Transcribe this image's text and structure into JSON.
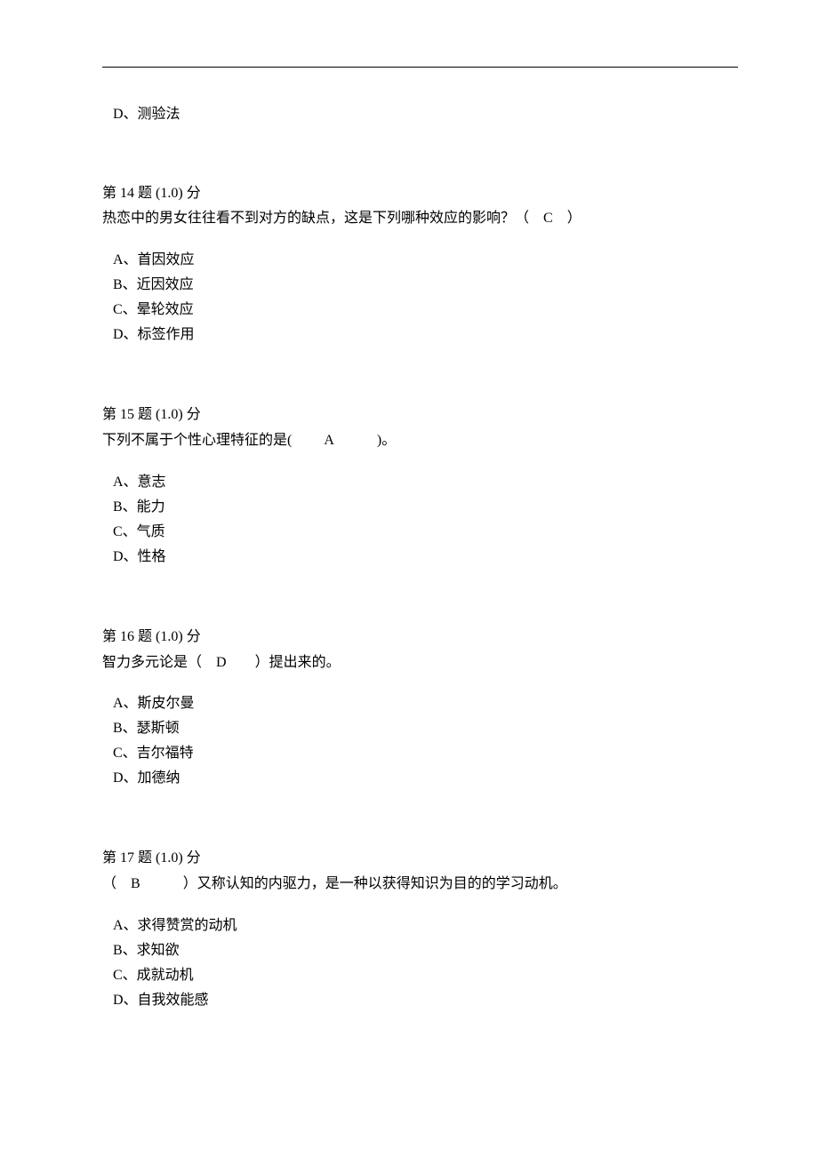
{
  "continuedOption": "D、测验法",
  "questions": [
    {
      "header_prefix": "第 ",
      "header_num": "14",
      "header_suffix": " 题 ",
      "header_points": "(1.0)",
      "header_points_unit": " 分",
      "text_before": "热恋中的男女往往看不到对方的缺点，这是下列哪种效应的影响？（ ",
      "answer": "C",
      "text_after": " ）",
      "options": [
        "A、首因效应",
        "B、近因效应",
        "C、晕轮效应",
        "D、标签作用"
      ]
    },
    {
      "header_prefix": "第 ",
      "header_num": "15",
      "header_suffix": " 题 ",
      "header_points": "(1.0)",
      "header_points_unit": " 分",
      "text_before": "下列不属于个性心理特征的是(   ",
      "answer": "A",
      "text_after": "   )。",
      "options": [
        "A、意志",
        "B、能力",
        "C、气质",
        "D、性格"
      ]
    },
    {
      "header_prefix": "第 ",
      "header_num": "16",
      "header_suffix": " 题 ",
      "header_points": "(1.0)",
      "header_points_unit": " 分",
      "text_before": "智力多元论是（ ",
      "answer": "D",
      "text_after": "  ）提出来的。",
      "options": [
        "A、斯皮尔曼",
        "B、瑟斯顿",
        "C、吉尔福特",
        "D、加德纳"
      ]
    },
    {
      "header_prefix": "第 ",
      "header_num": "17",
      "header_suffix": " 题 ",
      "header_points": "(1.0)",
      "header_points_unit": " 分",
      "text_before": "（ ",
      "answer": "B",
      "text_after": "   ）又称认知的内驱力，是一种以获得知识为目的的学习动机。",
      "options": [
        "A、求得赞赏的动机",
        "B、求知欲",
        "C、成就动机",
        "D、自我效能感"
      ]
    }
  ]
}
